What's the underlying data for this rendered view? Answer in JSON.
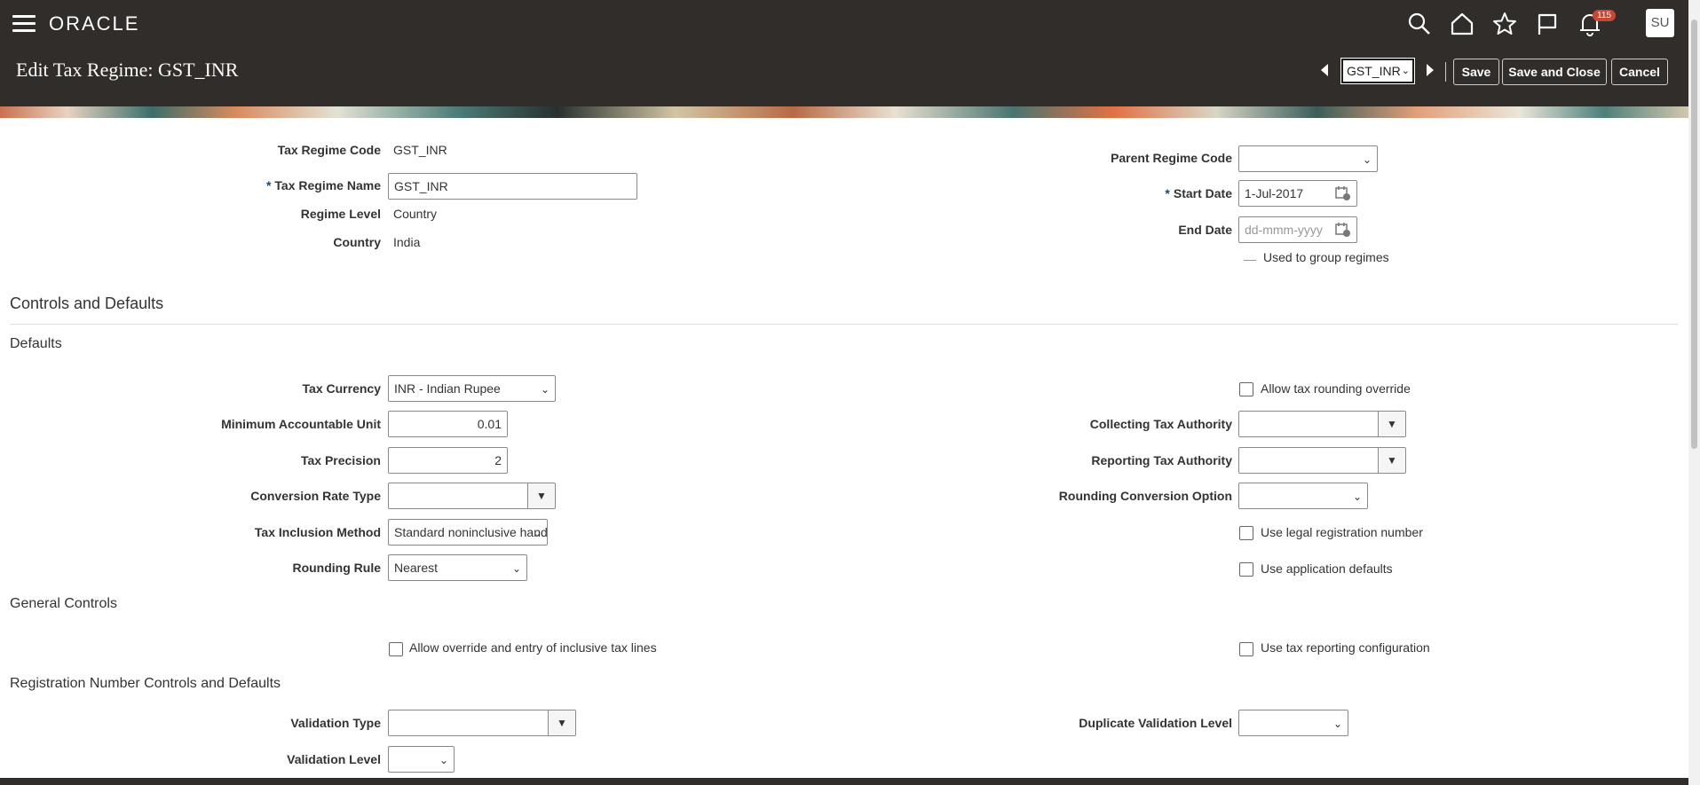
{
  "header": {
    "logo": "ORACLE",
    "page_title": "Edit Tax Regime: GST_INR",
    "notification_count": "115",
    "user_initials": "SU",
    "record_selector": "GST_INR",
    "buttons": {
      "save": "Save",
      "save_and_close": "Save and Close",
      "cancel": "Cancel"
    },
    "icons": [
      "menu-icon",
      "search-icon",
      "home-icon",
      "star-icon",
      "flag-icon",
      "bell-icon"
    ]
  },
  "regime": {
    "tax_regime_code_label": "Tax Regime Code",
    "tax_regime_code": "GST_INR",
    "tax_regime_name_label": "Tax Regime Name",
    "tax_regime_name": "GST_INR",
    "regime_level_label": "Regime Level",
    "regime_level": "Country",
    "country_label": "Country",
    "country": "India",
    "parent_regime_code_label": "Parent Regime Code",
    "parent_regime_code": "",
    "start_date_label": "Start Date",
    "start_date": "1-Jul-2017",
    "end_date_label": "End Date",
    "end_date_placeholder": "dd-mmm-yyyy",
    "used_to_group": "Used to group regimes"
  },
  "controls": {
    "title": "Controls and Defaults",
    "defaults_title": "Defaults",
    "tax_currency_label": "Tax Currency",
    "tax_currency": "INR - Indian Rupee",
    "min_unit_label": "Minimum Accountable Unit",
    "min_unit": "0.01",
    "precision_label": "Tax Precision",
    "precision": "2",
    "conversion_rate_label": "Conversion Rate Type",
    "conversion_rate": "",
    "inclusion_method_label": "Tax Inclusion Method",
    "inclusion_method": "Standard noninclusive handli",
    "rounding_rule_label": "Rounding Rule",
    "rounding_rule": "Nearest",
    "allow_rounding_override": "Allow tax rounding override",
    "collecting_authority_label": "Collecting Tax Authority",
    "reporting_authority_label": "Reporting Tax Authority",
    "rounding_conversion_label": "Rounding Conversion Option",
    "use_legal_registration": "Use legal registration number",
    "use_application_defaults": "Use application defaults"
  },
  "general": {
    "title": "General Controls",
    "allow_inclusive": "Allow override and entry of inclusive tax lines",
    "use_tax_reporting": "Use tax reporting configuration"
  },
  "registration": {
    "title": "Registration Number Controls and Defaults",
    "validation_type_label": "Validation Type",
    "validation_level_label": "Validation Level",
    "duplicate_level_label": "Duplicate Validation Level"
  }
}
